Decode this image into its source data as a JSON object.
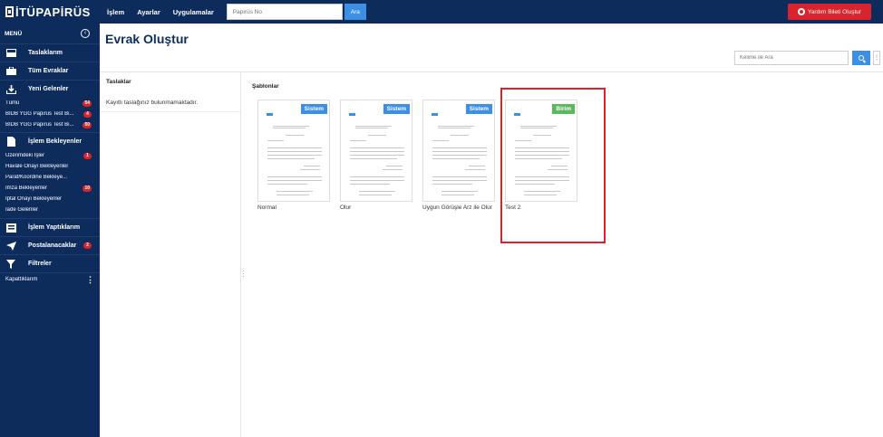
{
  "brand": {
    "name": "İTÜPAPİRÜS"
  },
  "topnav": [
    "İşlem",
    "Ayarlar",
    "Uygulamalar"
  ],
  "search": {
    "placeholder": "Papirüs No",
    "button": "Ara"
  },
  "help_button": "Yardım Bileti Oluştur",
  "sidebar": {
    "menu_title": "MENÜ",
    "sections": [
      {
        "label": "Taslaklarım",
        "icon": "inbox-icon"
      },
      {
        "label": "Tüm Evraklar",
        "icon": "briefcase-icon"
      },
      {
        "label": "Yeni Gelenler",
        "icon": "download-icon"
      }
    ],
    "new_items": [
      {
        "label": "Tümü",
        "badge": "54"
      },
      {
        "label": "BİDB YGG Papirus Test Bi...",
        "badge": "4"
      },
      {
        "label": "BİDB YGG Papirus Test Bi...",
        "badge": "50"
      }
    ],
    "pending_section": {
      "label": "İşlem Bekleyenler",
      "icon": "document-icon"
    },
    "pending_items": [
      {
        "label": "Üzerimdeki İşler",
        "badge": "1"
      },
      {
        "label": "Havale Onayı Bekleyenler",
        "badge": ""
      },
      {
        "label": "Paraf/Koordine Bekleye...",
        "badge": ""
      },
      {
        "label": "İmza Bekleyenler",
        "badge": "10"
      },
      {
        "label": "İptal Onayı Bekleyenler",
        "badge": ""
      },
      {
        "label": "İade Gelenler",
        "badge": ""
      }
    ],
    "done_section": {
      "label": "İşlem Yaptıklarım",
      "icon": "stack-icon"
    },
    "mail_section": {
      "label": "Postalanacaklar",
      "icon": "paper-plane-icon",
      "badge": "2"
    },
    "filter_section": {
      "label": "Filtreler",
      "icon": "filter-icon"
    },
    "footer": {
      "label": "Kapattıklarım"
    }
  },
  "main": {
    "title": "Evrak Oluştur",
    "word_search_placeholder": "Kelime ile Ara",
    "drafts_title": "Taslaklar",
    "drafts_empty": "Kayıtlı taslağınız bulunmamaktadır.",
    "templates_title": "Şablonlar",
    "templates": [
      {
        "label": "Normal",
        "tag": "Sistem"
      },
      {
        "label": "Olur",
        "tag": "Sistem"
      },
      {
        "label": "Uygun Görüşle Arz ile Olur",
        "tag": "Sistem"
      },
      {
        "label": "Test 2",
        "tag": "Birim"
      }
    ]
  },
  "colors": {
    "navy": "#0d2c5c",
    "accent": "#3c8fe4",
    "danger": "#d9232d",
    "success": "#5cb85c"
  }
}
